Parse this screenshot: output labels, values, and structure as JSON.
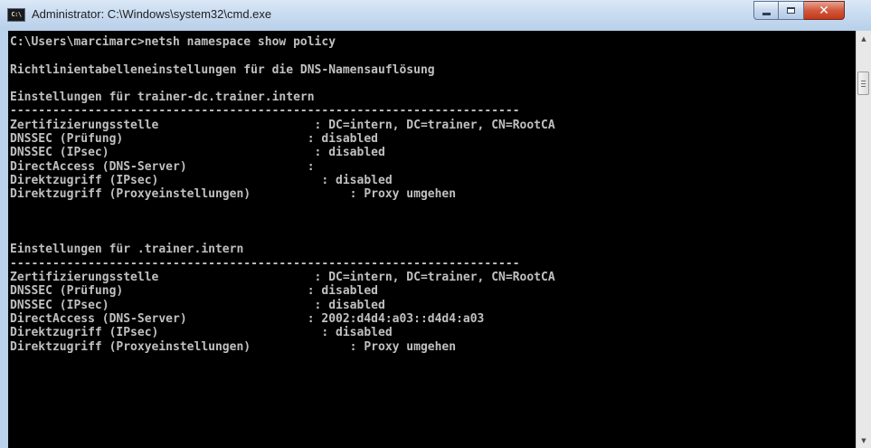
{
  "window": {
    "title": "Administrator: C:\\Windows\\system32\\cmd.exe",
    "icon_label": "C:\\"
  },
  "controls": {
    "close_glyph": "✕"
  },
  "console": {
    "text": "C:\\Users\\marcimarc>netsh namespace show policy\n\nRichtlinientabelleneinstellungen für die DNS-Namensauflösung\n\nEinstellungen für trainer-dc.trainer.intern\n------------------------------------------------------------------------\nZertifizierungsstelle                      : DC=intern, DC=trainer, CN=RootCA\nDNSSEC (Prüfung)                          : disabled\nDNSSEC (IPsec)                             : disabled\nDirectAccess (DNS-Server)                 :\nDirektzugriff (IPsec)                       : disabled\nDirektzugriff (Proxyeinstellungen)              : Proxy umgehen\n\n\n\nEinstellungen für .trainer.intern\n------------------------------------------------------------------------\nZertifizierungsstelle                      : DC=intern, DC=trainer, CN=RootCA\nDNSSEC (Prüfung)                          : disabled\nDNSSEC (IPsec)                             : disabled\nDirectAccess (DNS-Server)                 : 2002:d4d4:a03::d4d4:a03\nDirektzugriff (IPsec)                       : disabled\nDirektzugriff (Proxyeinstellungen)              : Proxy umgehen"
  },
  "scrollbar": {
    "up_glyph": "▲",
    "down_glyph": "▼"
  }
}
